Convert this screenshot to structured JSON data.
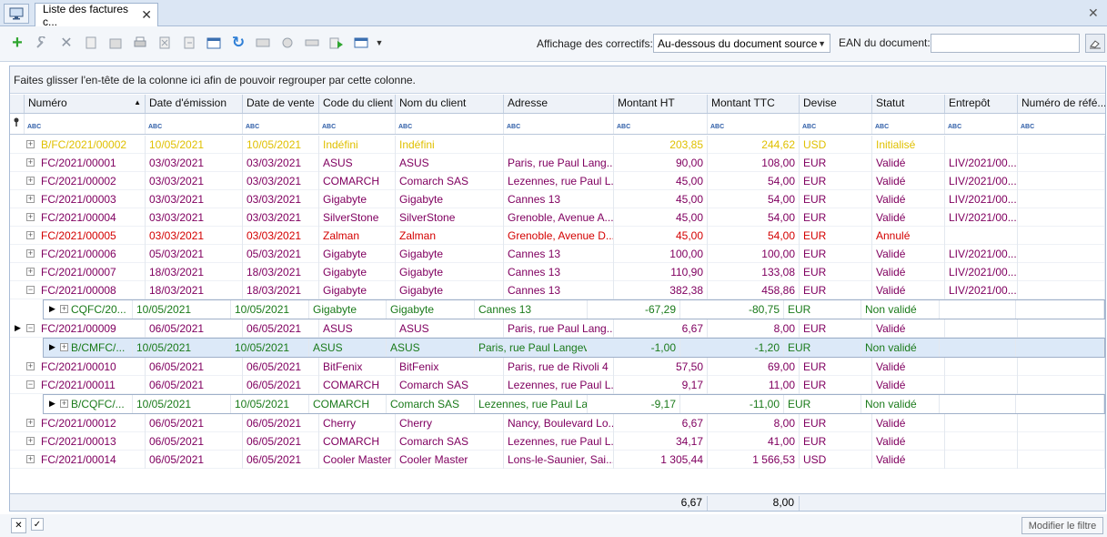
{
  "tab": {
    "title": "Liste des factures c...",
    "close": "✕"
  },
  "toolbar": {
    "correctifs_label": "Affichage des correctifs:",
    "correctifs_value": "Au-dessous du document source",
    "ean_label": "EAN du document:",
    "ean_value": ""
  },
  "grid": {
    "group_hint": "Faites glisser l'en-tête de la colonne ici afin de pouvoir regrouper par cette colonne.",
    "columns": [
      "Numéro",
      "Date d'émission",
      "Date de vente",
      "Code du client",
      "Nom du client",
      "Adresse",
      "Montant HT",
      "Montant TTC",
      "Devise",
      "Statut",
      "Entrepôt",
      "Numéro de réfé..."
    ],
    "filter_glyph": "ABC",
    "footer_ht": "6,67",
    "footer_ttc": "8,00"
  },
  "rows": [
    {
      "num": "B/FC/2021/00002",
      "emission": "10/05/2021",
      "vente": "10/05/2021",
      "code": "Indéfini",
      "nom": "Indéfini",
      "adresse": "",
      "ht": "203,85",
      "ttc": "244,62",
      "devise": "USD",
      "statut": "Initialisé",
      "entrepot": "",
      "ref": "",
      "color": "#e0c000",
      "pm": "+"
    },
    {
      "num": "FC/2021/00001",
      "emission": "03/03/2021",
      "vente": "03/03/2021",
      "code": "ASUS",
      "nom": "ASUS",
      "adresse": "Paris, rue Paul Lang...",
      "ht": "90,00",
      "ttc": "108,00",
      "devise": "EUR",
      "statut": "Validé",
      "entrepot": "LIV/2021/00...",
      "ref": "",
      "color": "#800060",
      "pm": "+"
    },
    {
      "num": "FC/2021/00002",
      "emission": "03/03/2021",
      "vente": "03/03/2021",
      "code": "COMARCH",
      "nom": "Comarch SAS",
      "adresse": "Lezennes, rue Paul L...",
      "ht": "45,00",
      "ttc": "54,00",
      "devise": "EUR",
      "statut": "Validé",
      "entrepot": "LIV/2021/00...",
      "ref": "",
      "color": "#800060",
      "pm": "+"
    },
    {
      "num": "FC/2021/00003",
      "emission": "03/03/2021",
      "vente": "03/03/2021",
      "code": "Gigabyte",
      "nom": "Gigabyte",
      "adresse": "Cannes 13",
      "ht": "45,00",
      "ttc": "54,00",
      "devise": "EUR",
      "statut": "Validé",
      "entrepot": "LIV/2021/00...",
      "ref": "",
      "color": "#800060",
      "pm": "+"
    },
    {
      "num": "FC/2021/00004",
      "emission": "03/03/2021",
      "vente": "03/03/2021",
      "code": "SilverStone",
      "nom": "SilverStone",
      "adresse": "Grenoble, Avenue A...",
      "ht": "45,00",
      "ttc": "54,00",
      "devise": "EUR",
      "statut": "Validé",
      "entrepot": "LIV/2021/00...",
      "ref": "",
      "color": "#800060",
      "pm": "+"
    },
    {
      "num": "FC/2021/00005",
      "emission": "03/03/2021",
      "vente": "03/03/2021",
      "code": "Zalman",
      "nom": "Zalman",
      "adresse": "Grenoble, Avenue D...",
      "ht": "45,00",
      "ttc": "54,00",
      "devise": "EUR",
      "statut": "Annulé",
      "entrepot": "",
      "ref": "",
      "color": "#d40000",
      "pm": "+"
    },
    {
      "num": "FC/2021/00006",
      "emission": "05/03/2021",
      "vente": "05/03/2021",
      "code": "Gigabyte",
      "nom": "Gigabyte",
      "adresse": "Cannes 13",
      "ht": "100,00",
      "ttc": "100,00",
      "devise": "EUR",
      "statut": "Validé",
      "entrepot": "LIV/2021/00...",
      "ref": "",
      "color": "#800060",
      "pm": "+"
    },
    {
      "num": "FC/2021/00007",
      "emission": "18/03/2021",
      "vente": "18/03/2021",
      "code": "Gigabyte",
      "nom": "Gigabyte",
      "adresse": "Cannes 13",
      "ht": "110,90",
      "ttc": "133,08",
      "devise": "EUR",
      "statut": "Validé",
      "entrepot": "LIV/2021/00...",
      "ref": "",
      "color": "#800060",
      "pm": "+"
    },
    {
      "num": "FC/2021/00008",
      "emission": "18/03/2021",
      "vente": "18/03/2021",
      "code": "Gigabyte",
      "nom": "Gigabyte",
      "adresse": "Cannes 13",
      "ht": "382,38",
      "ttc": "458,86",
      "devise": "EUR",
      "statut": "Validé",
      "entrepot": "LIV/2021/00...",
      "ref": "",
      "color": "#800060",
      "pm": "−"
    },
    {
      "sub": true,
      "num": "CQFC/20...",
      "emission": "10/05/2021",
      "vente": "10/05/2021",
      "code": "Gigabyte",
      "nom": "Gigabyte",
      "adresse": "Cannes 13",
      "ht": "-67,29",
      "ttc": "-80,75",
      "devise": "EUR",
      "statut": "Non validé",
      "entrepot": "",
      "ref": "",
      "color": "#1a7a1a"
    },
    {
      "num": "FC/2021/00009",
      "emission": "06/05/2021",
      "vente": "06/05/2021",
      "code": "ASUS",
      "nom": "ASUS",
      "adresse": "Paris, rue Paul Lang...",
      "ht": "6,67",
      "ttc": "8,00",
      "devise": "EUR",
      "statut": "Validé",
      "entrepot": "",
      "ref": "",
      "color": "#800060",
      "pm": "−",
      "current": true
    },
    {
      "sub": true,
      "sel": true,
      "num": "B/CMFC/...",
      "emission": "10/05/2021",
      "vente": "10/05/2021",
      "code": "ASUS",
      "nom": "ASUS",
      "adresse": "Paris, rue Paul Langev...",
      "ht": "-1,00",
      "ttc": "-1,20",
      "devise": "EUR",
      "statut": "Non validé",
      "entrepot": "",
      "ref": "",
      "color": "#1a7a1a"
    },
    {
      "num": "FC/2021/00010",
      "emission": "06/05/2021",
      "vente": "06/05/2021",
      "code": "BitFenix",
      "nom": "BitFenix",
      "adresse": "Paris, rue de Rivoli 4",
      "ht": "57,50",
      "ttc": "69,00",
      "devise": "EUR",
      "statut": "Validé",
      "entrepot": "",
      "ref": "",
      "color": "#800060",
      "pm": "+"
    },
    {
      "num": "FC/2021/00011",
      "emission": "06/05/2021",
      "vente": "06/05/2021",
      "code": "COMARCH",
      "nom": "Comarch SAS",
      "adresse": "Lezennes, rue Paul L...",
      "ht": "9,17",
      "ttc": "11,00",
      "devise": "EUR",
      "statut": "Validé",
      "entrepot": "",
      "ref": "",
      "color": "#800060",
      "pm": "−"
    },
    {
      "sub": true,
      "num": "B/CQFC/...",
      "emission": "10/05/2021",
      "vente": "10/05/2021",
      "code": "COMARCH",
      "nom": "Comarch SAS",
      "adresse": "Lezennes, rue Paul La...",
      "ht": "-9,17",
      "ttc": "-11,00",
      "devise": "EUR",
      "statut": "Non validé",
      "entrepot": "",
      "ref": "",
      "color": "#1a7a1a"
    },
    {
      "num": "FC/2021/00012",
      "emission": "06/05/2021",
      "vente": "06/05/2021",
      "code": "Cherry",
      "nom": "Cherry",
      "adresse": "Nancy, Boulevard Lo...",
      "ht": "6,67",
      "ttc": "8,00",
      "devise": "EUR",
      "statut": "Validé",
      "entrepot": "",
      "ref": "",
      "color": "#800060",
      "pm": "+"
    },
    {
      "num": "FC/2021/00013",
      "emission": "06/05/2021",
      "vente": "06/05/2021",
      "code": "COMARCH",
      "nom": "Comarch SAS",
      "adresse": "Lezennes, rue Paul L...",
      "ht": "34,17",
      "ttc": "41,00",
      "devise": "EUR",
      "statut": "Validé",
      "entrepot": "",
      "ref": "",
      "color": "#800060",
      "pm": "+"
    },
    {
      "num": "FC/2021/00014",
      "emission": "06/05/2021",
      "vente": "06/05/2021",
      "code": "Cooler Master",
      "nom": "Cooler Master",
      "adresse": "Lons-le-Saunier, Sai...",
      "ht": "1 305,44",
      "ttc": "1 566,53",
      "devise": "USD",
      "statut": "Validé",
      "entrepot": "",
      "ref": "",
      "color": "#800060",
      "pm": "+"
    }
  ],
  "bottom": {
    "modify_filter": "Modifier le filtre",
    "clear_icon": "✕",
    "check_icon": "✓"
  }
}
